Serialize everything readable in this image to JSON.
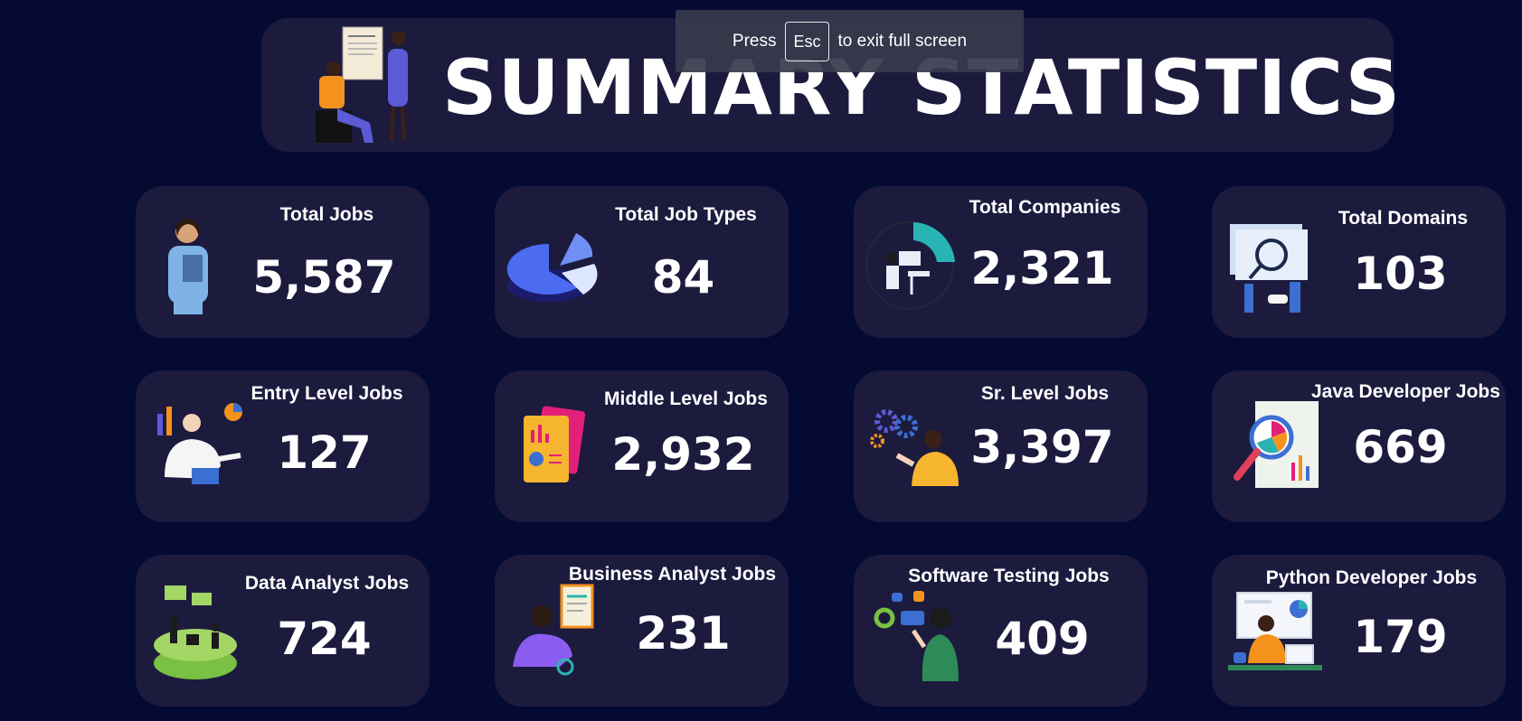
{
  "fullscreen_toast": {
    "press": "Press",
    "key": "Esc",
    "suffix": "to exit full screen"
  },
  "header": {
    "title": "SUMMARY STATISTICS",
    "illustration": "two-people-document-icon"
  },
  "cards": [
    {
      "label": "Total Jobs",
      "value": "5,587",
      "icon": "woman-clipboard-icon"
    },
    {
      "label": "Total Job Types",
      "value": "84",
      "icon": "pie-chart-3d-icon"
    },
    {
      "label": "Total Companies",
      "value": "2,321",
      "icon": "person-dashboard-icon"
    },
    {
      "label": "Total Domains",
      "value": "103",
      "icon": "proposal-search-icon"
    },
    {
      "label": "Entry Level Jobs",
      "value": "127",
      "icon": "person-laptop-charts-icon"
    },
    {
      "label": "Middle Level Jobs",
      "value": "2,932",
      "icon": "report-documents-icon"
    },
    {
      "label": "Sr. Level Jobs",
      "value": "3,397",
      "icon": "person-gears-icon"
    },
    {
      "label": "Java Developer Jobs",
      "value": "669",
      "icon": "magnifier-report-icon"
    },
    {
      "label": "Data Analyst Jobs",
      "value": "724",
      "icon": "data-platform-icon"
    },
    {
      "label": "Business Analyst Jobs",
      "value": "231",
      "icon": "analyst-clipboard-icon"
    },
    {
      "label": "Software Testing Jobs",
      "value": "409",
      "icon": "tester-camera-icon"
    },
    {
      "label": "Python Developer Jobs",
      "value": "179",
      "icon": "developer-desk-icon"
    }
  ]
}
